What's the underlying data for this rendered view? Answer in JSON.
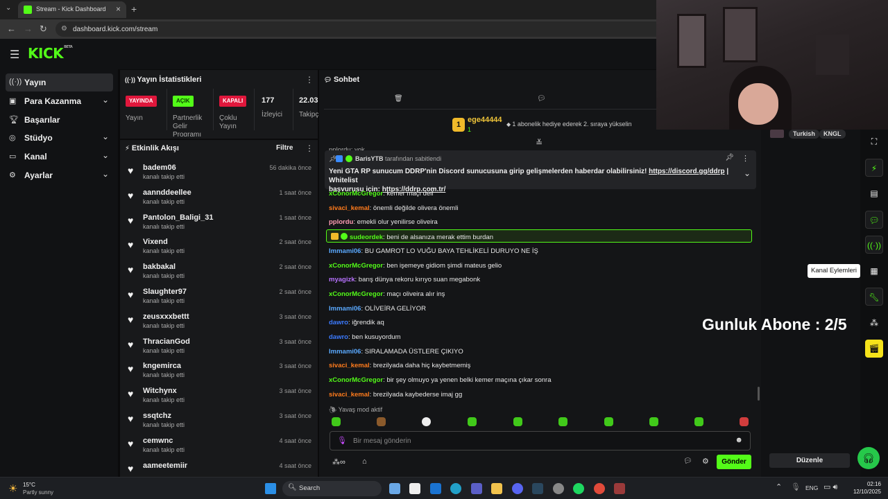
{
  "browser": {
    "tab_title": "Stream - Kick Dashboard",
    "url": "dashboard.kick.com/stream"
  },
  "header": {
    "logo": "KICK",
    "logo_badge": "BETA"
  },
  "sidebar": {
    "items": [
      {
        "label": "Yayın",
        "icon": "broadcast-icon",
        "active": true,
        "expandable": false
      },
      {
        "label": "Para Kazanma",
        "icon": "money-icon",
        "active": false,
        "expandable": true
      },
      {
        "label": "Başarılar",
        "icon": "trophy-icon",
        "active": false,
        "expandable": false
      },
      {
        "label": "Stüdyo",
        "icon": "studio-icon",
        "active": false,
        "expandable": true
      },
      {
        "label": "Kanal",
        "icon": "channel-icon",
        "active": false,
        "expandable": true
      },
      {
        "label": "Ayarlar",
        "icon": "gear-icon",
        "active": false,
        "expandable": true
      }
    ]
  },
  "stats": {
    "title": "Yayın İstatistikleri",
    "badges": [
      {
        "badge": "YAYINDA",
        "label": "Yayın",
        "color": "#e0173c"
      },
      {
        "badge": "AÇIK",
        "label": "Partnerlik Gelir Programı",
        "color": "#53fc18"
      },
      {
        "badge": "KAPALI",
        "label": "Çoklu Yayın",
        "color": "#e0173c"
      }
    ],
    "viewers": {
      "value": "177",
      "label": "İzleyici"
    },
    "followers": {
      "value": "22.03",
      "label": "Takipç"
    }
  },
  "feed": {
    "title": "Etkinlik Akışı",
    "filter_label": "Filtre",
    "items": [
      {
        "name": "badem06",
        "action": "kanalı takip etti",
        "time": "56 dakika önce"
      },
      {
        "name": "aannddeellee",
        "action": "kanalı takip etti",
        "time": "1 saat önce"
      },
      {
        "name": "Pantolon_Baligi_31",
        "action": "kanalı takip etti",
        "time": "1 saat önce"
      },
      {
        "name": "Vixend",
        "action": "kanalı takip etti",
        "time": "2 saat önce"
      },
      {
        "name": "bakbakal",
        "action": "kanalı takip etti",
        "time": "2 saat önce"
      },
      {
        "name": "Slaughter97",
        "action": "kanalı takip etti",
        "time": "2 saat önce"
      },
      {
        "name": "zeusxxxbettt",
        "action": "kanalı takip etti",
        "time": "3 saat önce"
      },
      {
        "name": "ThracianGod",
        "action": "kanalı takip etti",
        "time": "3 saat önce"
      },
      {
        "name": "kngemirca",
        "action": "kanalı takip etti",
        "time": "3 saat önce"
      },
      {
        "name": "Witchynx",
        "action": "kanalı takip etti",
        "time": "3 saat önce"
      },
      {
        "name": "ssqtchz",
        "action": "kanalı takip etti",
        "time": "3 saat önce"
      },
      {
        "name": "cemwnc",
        "action": "kanalı takip etti",
        "time": "4 saat önce"
      },
      {
        "name": "aameetemiir",
        "action": "",
        "time": "4 saat önce"
      }
    ]
  },
  "chat": {
    "title": "Sohbet",
    "gift": {
      "user": "ege44444",
      "count": "1",
      "text": "1 abonelik hediye ederek 2. sıraya yükselin"
    },
    "partial_line": "pplordu: yok",
    "pinned": {
      "by_user": "BarisYTB",
      "by_suffix": "tarafından sabitlendi",
      "text_1": "Yeni GTA RP sunucum DDRP'nin Discord sunucusuna girip gelişmelerden haberdar olabilirsiniz!",
      "link_1": "https://discord.gg/ddrp",
      "text_2": "| Whitelist",
      "text_3": "başvurusu için:",
      "link_2": "https://ddrp.com.tr/"
    },
    "messages": [
      {
        "user": "xConorMcGregor",
        "color": "#53fc18",
        "text": "kemer maçı deil",
        "highlight": false
      },
      {
        "user": "sivaci_kemal",
        "color": "#ff7b1c",
        "text": "önemli değilde olivera önemli",
        "highlight": false
      },
      {
        "user": "pplordu",
        "color": "#ff9db5",
        "text": "emekli olur yenilirse oliveira",
        "highlight": false
      },
      {
        "user": "sudeordek",
        "color": "#53fc18",
        "text": "beni de alsanıza merak ettim burdan",
        "highlight": true
      },
      {
        "user": "Immami06",
        "color": "#5aa9ff",
        "text": "BU GAMROT LO VUĞU BAYA TEHLİKELİ DURUYO NE İŞ",
        "highlight": false
      },
      {
        "user": "xConorMcGregor",
        "color": "#53fc18",
        "text": "ben işemeye gidiom şimdi mateus gelio",
        "highlight": false
      },
      {
        "user": "myagizk",
        "color": "#b873ff",
        "text": "barış dünya rekoru kırıyo suan megabonk",
        "highlight": false
      },
      {
        "user": "xConorMcGregor",
        "color": "#53fc18",
        "text": "maçı oliveira alır inş",
        "highlight": false
      },
      {
        "user": "Immami06",
        "color": "#5aa9ff",
        "text": "OLİVEİRA GELİYOR",
        "highlight": false
      },
      {
        "user": "dawro",
        "color": "#3c7bff",
        "text": "iğrendik aq",
        "highlight": false
      },
      {
        "user": "dawro",
        "color": "#3c7bff",
        "text": "ben kusuyordum",
        "highlight": false
      },
      {
        "user": "Immami06",
        "color": "#5aa9ff",
        "text": "SIRALAMADA ÜSTLERE ÇIKIYO",
        "highlight": false
      },
      {
        "user": "sivaci_kemal",
        "color": "#ff7b1c",
        "text": "brezilyada daha hiç kaybetmemiş",
        "highlight": false
      },
      {
        "user": "xConorMcGregor",
        "color": "#53fc18",
        "text": "bir şey olmuyo ya yenen belki kemer maçına çıkar sonra",
        "highlight": false
      },
      {
        "user": "sivaci_kemal",
        "color": "#ff7b1c",
        "text": "brezilyada kaybederse imaj gg",
        "highlight": false
      }
    ],
    "slow_mode": "Yavaş mod aktif",
    "input_placeholder": "Bir mesaj gönderin",
    "send_label": "Gönder"
  },
  "overlay": {
    "sub_counter": "Gunluk Abone : 2/5",
    "tags": [
      "Turkish",
      "KNGL"
    ],
    "tooltip": "Kanal Eylemleri",
    "edit_label": "Düzenle"
  },
  "taskbar": {
    "weather_temp": "15°C",
    "weather_desc": "Partly sunny",
    "search_label": "Search",
    "lang": "ENG",
    "time": "02:16",
    "date": "12/10/2025"
  }
}
